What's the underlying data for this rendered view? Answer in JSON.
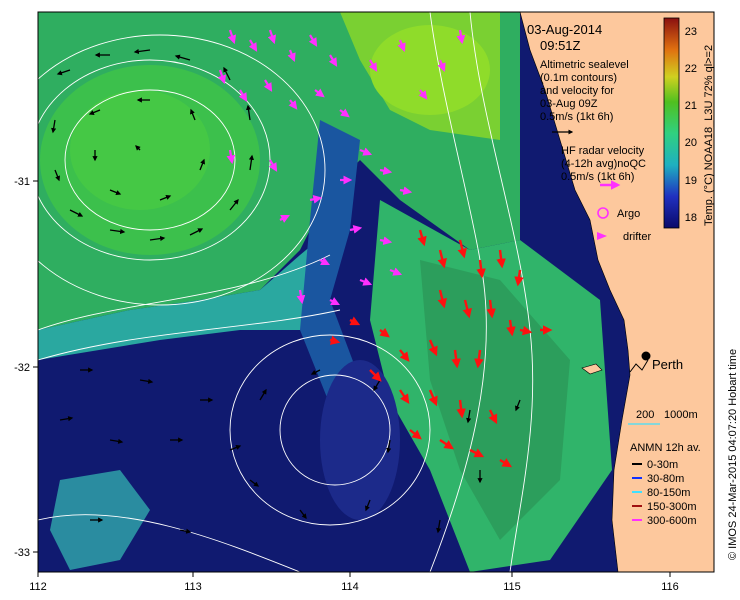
{
  "header": {
    "date": "03-Aug-2014",
    "time": "09:51Z"
  },
  "altimetry_note": [
    "Altimetric sealevel",
    "(0.1m contours)",
    "and velocity for",
    "03-Aug 09Z",
    "0.5m/s (1kt 6h)"
  ],
  "hf_radar_note": [
    "HF radar velocity",
    "(4-12h avg)noQC",
    "0.5m/s (1kt 6h)"
  ],
  "legend_markers": {
    "argo": "Argo",
    "drifter": "drifter"
  },
  "city": "Perth",
  "isobaths": {
    "a": "200",
    "b": "1000m"
  },
  "anmn": {
    "title": "ANMN 12h av.",
    "items": [
      {
        "label": "0-30m",
        "color": "#000000"
      },
      {
        "label": "30-80m",
        "color": "#1030ff"
      },
      {
        "label": "80-150m",
        "color": "#40e0ff"
      },
      {
        "label": "150-300m",
        "color": "#a01010"
      },
      {
        "label": "300-600m",
        "color": "#ff30ff"
      }
    ]
  },
  "colorbar": {
    "label": "Temp. (°C) NOAA18_L3U 72% ql>=2",
    "ticks": [
      "23",
      "22",
      "21",
      "20",
      "19",
      "18"
    ],
    "range": [
      17.7,
      23.3
    ]
  },
  "axes": {
    "lon_ticks": [
      "112",
      "113",
      "114",
      "115",
      "116"
    ],
    "lat_ticks": [
      "-31",
      "-32",
      "-33"
    ],
    "lon_range": [
      112,
      116.3
    ],
    "lat_range": [
      -33.1,
      -30.1
    ]
  },
  "credit": "© IMOS 24-Mar-2015 04:07:20 Hobart time",
  "colors": {
    "land": "#fdc89d",
    "ocean_deep": "#0f1660",
    "warm_water": "#2fa05e",
    "hf_vectors": "#ff30ff",
    "hf_shelf_vectors": "#ff1010",
    "altimetry_vectors": "#000000"
  }
}
